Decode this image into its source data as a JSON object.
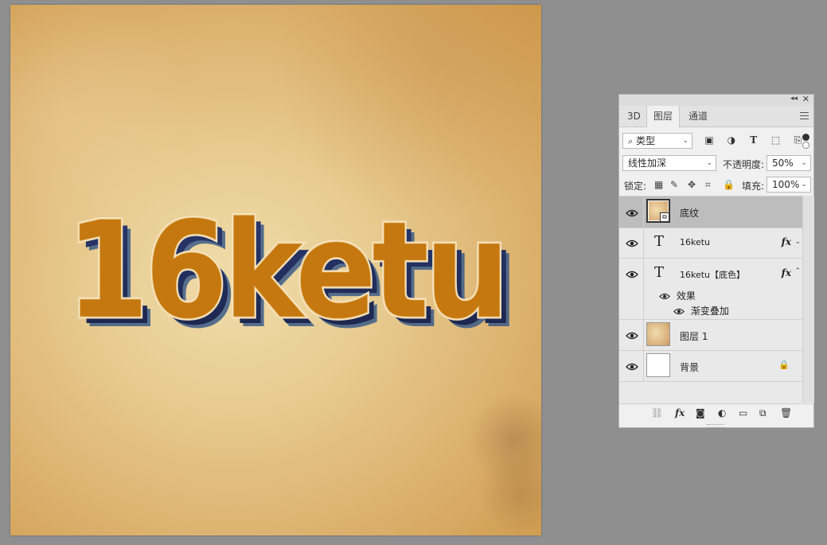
{
  "canvas": {
    "artwork_text": "16ketu"
  },
  "panel": {
    "tabs": [
      {
        "label": "3D"
      },
      {
        "label": "图层"
      },
      {
        "label": "通道"
      }
    ],
    "filter": {
      "kind_label": "类型"
    },
    "blend_mode": "线性加深",
    "opacity_label": "不透明度:",
    "opacity_value": "50%",
    "lock_label": "锁定:",
    "fill_label": "填充:",
    "fill_value": "100%",
    "layers": [
      {
        "name": "底纹",
        "kind": "smart-object",
        "selected": true
      },
      {
        "name": "16ketu",
        "kind": "text",
        "has_fx": true,
        "fx_label": "fx"
      },
      {
        "name": "16ketu【底色】",
        "kind": "text",
        "has_fx": true,
        "fx_label": "fx",
        "effects_label": "效果",
        "effects": [
          "渐变叠加"
        ]
      },
      {
        "name": "图层 1",
        "kind": "image"
      },
      {
        "name": "背景",
        "kind": "background",
        "locked": true
      }
    ],
    "text_layer_glyph": "T"
  },
  "colors": {
    "artwork_fill": "#c4780f",
    "artwork_outline": "#f6e2bd",
    "artwork_shadow": "#24305f",
    "selected_layer": "#bdbdbd"
  }
}
